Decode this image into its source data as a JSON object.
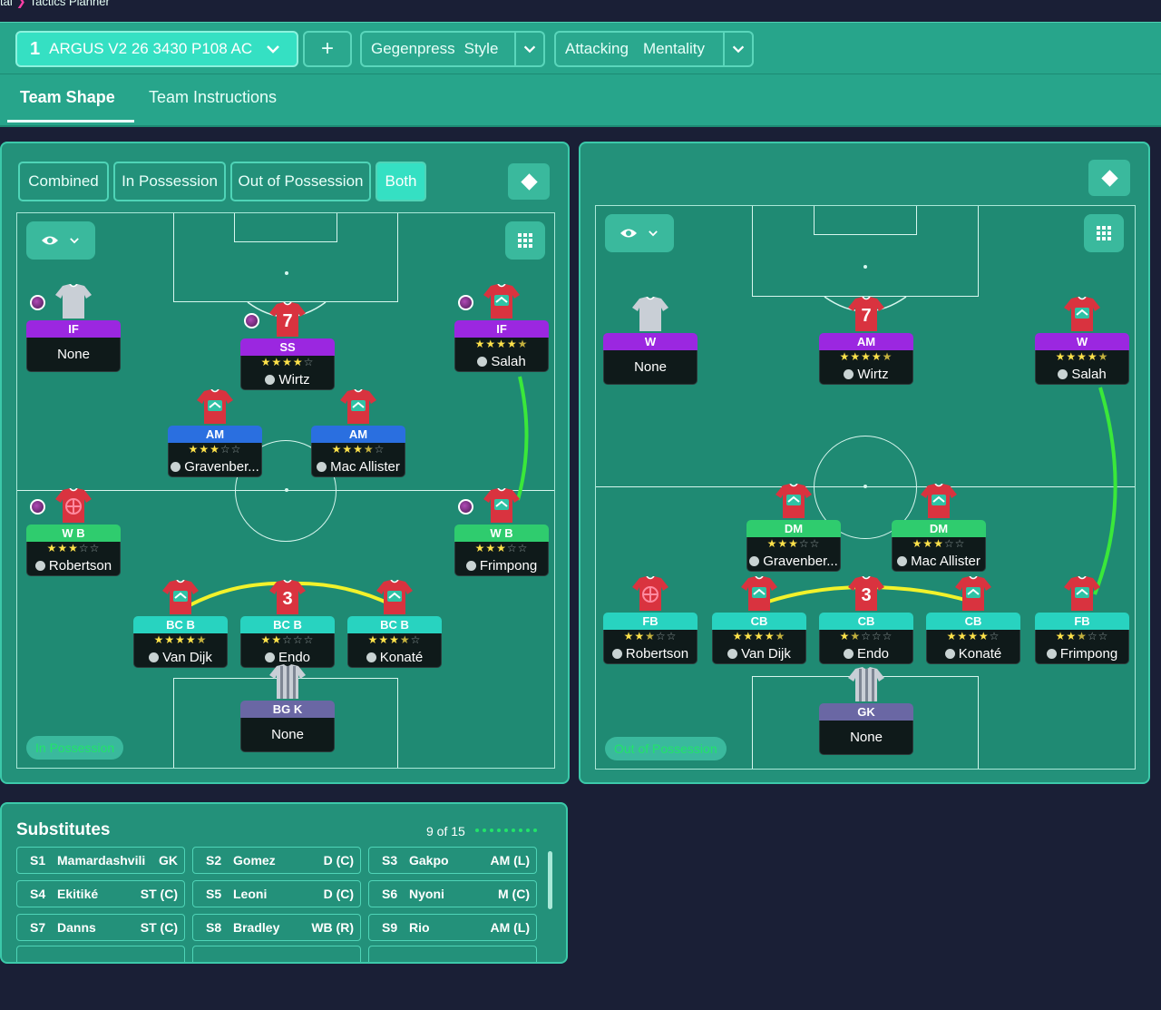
{
  "breadcrumb": {
    "parent": "tal",
    "current": "Tactics Planner"
  },
  "tactic": {
    "number": "1",
    "name": "ARGUS V2 26 3430 P108 AC",
    "add_label": "+"
  },
  "style": {
    "value": "Gegenpress",
    "label": "Style"
  },
  "mentality": {
    "value": "Attacking",
    "label": "Mentality"
  },
  "tabs": [
    "Team Shape",
    "Team Instructions"
  ],
  "view_toggle": [
    "Combined",
    "In Possession",
    "Out of Possession",
    "Both"
  ],
  "colors": {
    "accent": "#35e0c3",
    "panel": "#23917a",
    "background": "#1a1f36",
    "purple": "#9b27e0",
    "blue": "#2a6fe0",
    "green": "#2fcc6e",
    "cyan": "#28d3c0",
    "gk": "#6a67a4"
  },
  "in_possession": {
    "phase_label": "In Possession",
    "players": [
      {
        "role": "IF",
        "stars": 0,
        "name": "None",
        "color": "purple",
        "shirt": "empty"
      },
      {
        "role": "SS",
        "stars": 4,
        "name": "Wirtz",
        "color": "purple",
        "shirt": "7"
      },
      {
        "role": "IF",
        "stars": 4.5,
        "name": "Salah",
        "color": "purple",
        "shirt": "logo"
      },
      {
        "role": "AM",
        "stars": 3,
        "name": "Gravenber...",
        "color": "blue",
        "shirt": "logo"
      },
      {
        "role": "AM",
        "stars": 3.5,
        "name": "Mac Allister",
        "color": "blue",
        "shirt": "logo"
      },
      {
        "role": "W B",
        "stars": 3,
        "name": "Robertson",
        "color": "green",
        "shirt": "cross"
      },
      {
        "role": "W B",
        "stars": 3,
        "name": "Frimpong",
        "color": "green",
        "shirt": "logo"
      },
      {
        "role": "BC B",
        "stars": 4.5,
        "name": "Van Dijk",
        "color": "cyan",
        "shirt": "logo"
      },
      {
        "role": "BC B",
        "stars": 2,
        "name": "Endo",
        "color": "cyan",
        "shirt": "3"
      },
      {
        "role": "BC B",
        "stars": 3.5,
        "name": "Konaté",
        "color": "cyan",
        "shirt": "logo"
      },
      {
        "role": "BG K",
        "stars": 0,
        "name": "None",
        "color": "gk",
        "shirt": "gk"
      }
    ]
  },
  "out_of_possession": {
    "phase_label": "Out of Possession",
    "players": [
      {
        "role": "W",
        "stars": 0,
        "name": "None",
        "color": "purple",
        "shirt": "empty"
      },
      {
        "role": "AM",
        "stars": 4.5,
        "name": "Wirtz",
        "color": "purple",
        "shirt": "7"
      },
      {
        "role": "W",
        "stars": 4.5,
        "name": "Salah",
        "color": "purple",
        "shirt": "logo"
      },
      {
        "role": "DM",
        "stars": 3,
        "name": "Gravenber...",
        "color": "green",
        "shirt": "logo"
      },
      {
        "role": "DM",
        "stars": 3,
        "name": "Mac Allister",
        "color": "green",
        "shirt": "logo"
      },
      {
        "role": "FB",
        "stars": 2.5,
        "name": "Robertson",
        "color": "cyan",
        "shirt": "cross"
      },
      {
        "role": "CB",
        "stars": 4.5,
        "name": "Van Dijk",
        "color": "cyan",
        "shirt": "logo"
      },
      {
        "role": "CB",
        "stars": 1.5,
        "name": "Endo",
        "color": "cyan",
        "shirt": "3"
      },
      {
        "role": "CB",
        "stars": 4,
        "name": "Konaté",
        "color": "cyan",
        "shirt": "logo"
      },
      {
        "role": "FB",
        "stars": 2.5,
        "name": "Frimpong",
        "color": "cyan",
        "shirt": "logo"
      },
      {
        "role": "GK",
        "stars": 0,
        "name": "None",
        "color": "gk",
        "shirt": "gk"
      }
    ]
  },
  "substitutes": {
    "title": "Substitutes",
    "count": "9 of 15",
    "items": [
      {
        "slot": "S1",
        "name": "Mamardashvili",
        "pos": "GK"
      },
      {
        "slot": "S2",
        "name": "Gomez",
        "pos": "D (C)"
      },
      {
        "slot": "S3",
        "name": "Gakpo",
        "pos": "AM (L)"
      },
      {
        "slot": "S4",
        "name": "Ekitiké",
        "pos": "ST (C)"
      },
      {
        "slot": "S5",
        "name": "Leoni",
        "pos": "D (C)"
      },
      {
        "slot": "S6",
        "name": "Nyoni",
        "pos": "M (C)"
      },
      {
        "slot": "S7",
        "name": "Danns",
        "pos": "ST (C)"
      },
      {
        "slot": "S8",
        "name": "Bradley",
        "pos": "WB (R)"
      },
      {
        "slot": "S9",
        "name": "Rio",
        "pos": "AM (L)"
      }
    ]
  }
}
